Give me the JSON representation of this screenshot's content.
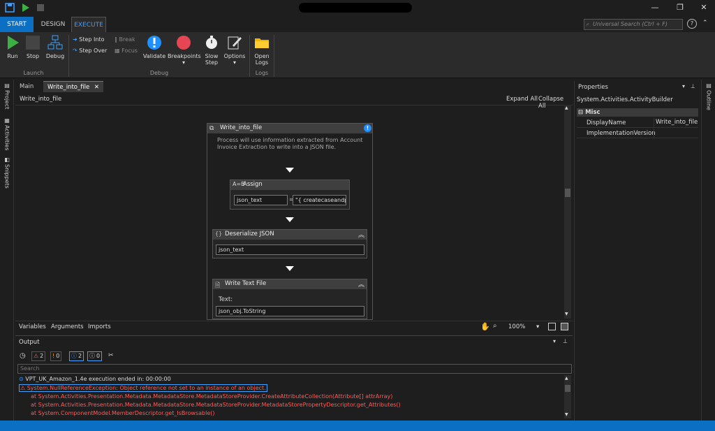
{
  "titlebar": {
    "minimize": "—",
    "restore": "❐",
    "close": "✕"
  },
  "tabs": {
    "start": "START",
    "design": "DESIGN",
    "execute": "EXECUTE"
  },
  "search": {
    "placeholder": "Universal Search (Ctrl + F)",
    "help": "?"
  },
  "ribbon": {
    "run": "Run",
    "stop": "Stop",
    "debug": "Debug",
    "step_into": "Step Into",
    "step_over": "Step Over",
    "break": "Break",
    "focus": "Focus",
    "validate": "Validate",
    "breakpoints": "Breakpoints",
    "slow_step": "Slow Step",
    "options": "Options",
    "open_logs": "Open Logs",
    "groups": {
      "launch": "Launch",
      "debug": "Debug",
      "logs": "Logs"
    }
  },
  "left_tabs": {
    "project": "Project",
    "activities": "Activities",
    "snippets": "Snippets"
  },
  "right_tabs": {
    "outline": "Outline"
  },
  "doc_tabs": {
    "main": "Main",
    "write_into_file": "Write_into_file",
    "close": "✕"
  },
  "designer": {
    "breadcrumb": "Write_into_file",
    "expand_all": "Expand All",
    "collapse_all": "Collapse All",
    "sequence": {
      "title": "Write_into_file",
      "description": "Process will use information extracted from Account Invoice Extraction to write into a JSON file."
    },
    "assign": {
      "title": "Assign",
      "to": "json_text",
      "eq": "=",
      "value": "\"{ createcaseandpr"
    },
    "deserialize": {
      "title": "Deserialize JSON",
      "input": "json_text"
    },
    "write_text": {
      "title": "Write Text File",
      "text_label": "Text:",
      "text_value": "json_obj.ToString"
    },
    "bottom": {
      "variables": "Variables",
      "arguments": "Arguments",
      "imports": "Imports",
      "zoom": "100%"
    }
  },
  "output": {
    "title": "Output",
    "filters": {
      "warnings": "2",
      "errors": "0",
      "info": "2",
      "trace": "0"
    },
    "search_placeholder": "Search",
    "logs": [
      "VPT_UK_Amazon_1.4e execution ended in: 00:00:00",
      "System.NullReferenceException: Object reference not set to an instance of an object.",
      "at System.Activities.Presentation.Metadata.MetadataStore.MetadataStoreProvider.CreateAttributeCollection(Attribute[] attrArray)",
      "at System.Activities.Presentation.Metadata.MetadataStore.MetadataStoreProvider.MetadataStorePropertyDescriptor.get_Attributes()",
      "at System.ComponentModel.MemberDescriptor.get_IsBrowsable()"
    ]
  },
  "properties": {
    "title": "Properties",
    "type": "System.Activities.ActivityBuilder",
    "category": "Misc",
    "rows": [
      {
        "name": "DisplayName",
        "value": "Write_into_file"
      },
      {
        "name": "ImplementationVersion",
        "value": ""
      }
    ]
  },
  "colors": {
    "accent": "#0b6fc3",
    "error": "#ff5c5c",
    "run": "#3cb043",
    "breakpoint": "#e64553"
  }
}
